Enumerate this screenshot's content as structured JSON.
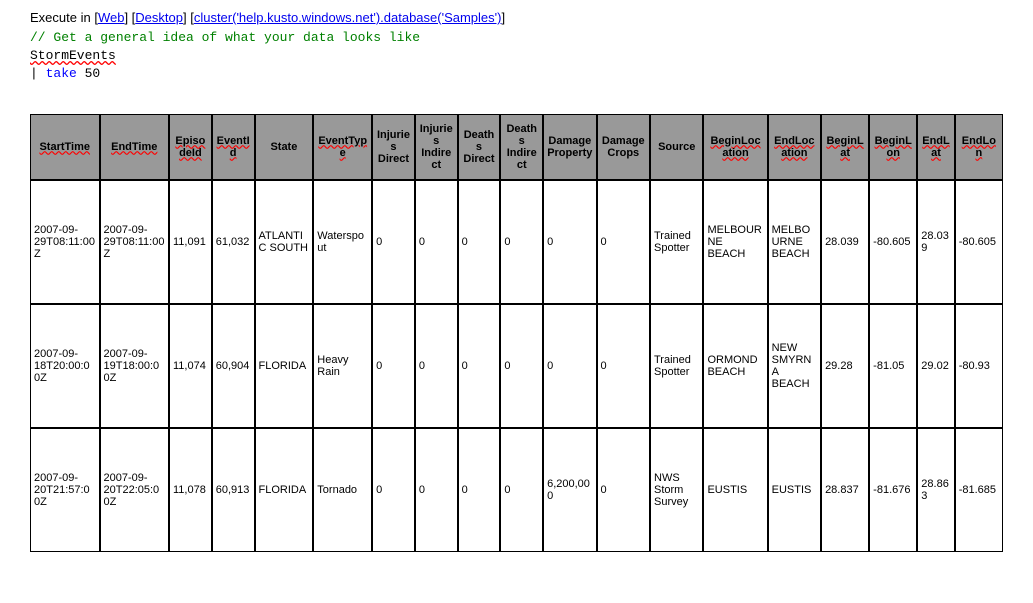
{
  "top": {
    "execute_label": "Execute in [",
    "link_web": "Web",
    "bracket1": "] [",
    "link_desktop": "Desktop",
    "bracket2": "] [",
    "link_cluster": "cluster('help.kusto.windows.net').database('Samples')",
    "bracket3": "]"
  },
  "code": {
    "comment": "// Get a general idea of what your data looks like",
    "table_name": "StormEvents",
    "pipe": "| ",
    "keyword": "take",
    "value": " 50"
  },
  "headers": [
    "StartTime",
    "EndTime",
    "EpisodeId",
    "EventId",
    "State",
    "EventType",
    "Injuries Direct",
    "Injuries Indirect",
    "Deaths Direct",
    "Deaths Indirect",
    "Damage Property",
    "Damage Crops",
    "Source",
    "BeginLocation",
    "EndLocation",
    "BeginLat",
    "BeginLon",
    "EndLat",
    "EndLon"
  ],
  "rows": [
    [
      "2007-09-29T08:11:00Z",
      "2007-09-29T08:11:00Z",
      "11,091",
      "61,032",
      "ATLANTIC SOUTH",
      "Waterspout",
      "0",
      "0",
      "0",
      "0",
      "0",
      "0",
      "Trained Spotter",
      "MELBOURNE BEACH",
      "MELBOURNE BEACH",
      "28.039",
      "-80.605",
      "28.039",
      "-80.605"
    ],
    [
      "2007-09-18T20:00:00Z",
      "2007-09-19T18:00:00Z",
      "11,074",
      "60,904",
      "FLORIDA",
      "Heavy Rain",
      "0",
      "0",
      "0",
      "0",
      "0",
      "0",
      "Trained Spotter",
      "ORMOND BEACH",
      "NEW SMYRNA BEACH",
      "29.28",
      "-81.05",
      "29.02",
      "-80.93"
    ],
    [
      "2007-09-20T21:57:00Z",
      "2007-09-20T22:05:00Z",
      "11,078",
      "60,913",
      "FLORIDA",
      "Tornado",
      "0",
      "0",
      "0",
      "0",
      "6,200,000",
      "0",
      "NWS Storm Survey",
      "EUSTIS",
      "EUSTIS",
      "28.837",
      "-81.676",
      "28.863",
      "-81.685"
    ]
  ]
}
